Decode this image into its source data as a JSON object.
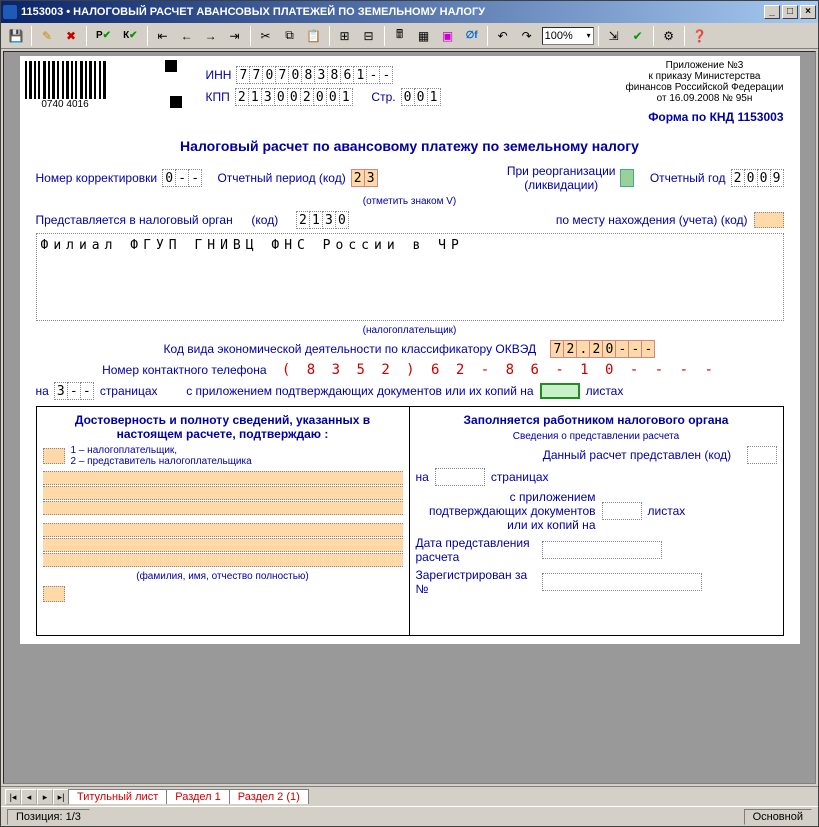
{
  "title": "1153003 • НАЛОГОВЫЙ РАСЧЕТ АВАНСОВЫХ ПЛАТЕЖЕЙ ПО ЗЕМЕЛЬНОМУ НАЛОГУ",
  "toolbar": {
    "zoom": "100%",
    "r": "Р",
    "k": "К"
  },
  "barcode_num": "0740 4016",
  "inn_label": "ИНН",
  "inn": [
    "7",
    "7",
    "0",
    "7",
    "0",
    "8",
    "3",
    "8",
    "6",
    "1",
    "-",
    "-"
  ],
  "kpp_label": "КПП",
  "kpp": [
    "2",
    "1",
    "3",
    "0",
    "0",
    "2",
    "0",
    "0",
    "1"
  ],
  "page_label": "Стр.",
  "page": [
    "0",
    "0",
    "1"
  ],
  "prilog": "Приложение №3\nк приказу Министерства\nфинансов Российской Федерации\nот 16.09.2008 № 95н",
  "form_knd": "Форма по КНД 1153003",
  "main_title": "Налоговый расчет по авансовому платежу по земельному налогу",
  "korr_label": "Номер корректировки",
  "korr": [
    "0",
    "-",
    "-"
  ],
  "period_label": "Отчетный период (код)",
  "period": [
    "2",
    "3"
  ],
  "reorg": "При реорганизации\n(ликвидации)",
  "year_label": "Отчетный год",
  "year": [
    "2",
    "0",
    "0",
    "9"
  ],
  "mark_v": "(отметить знаком V)",
  "pred_label": "Представляется в налоговый орган",
  "kod": "(код)",
  "organ": [
    "2",
    "1",
    "3",
    "0"
  ],
  "mesto": "по месту нахождения (учета) (код)",
  "payer": "Филиал ФГУП ГНИВЦ ФНС России в ЧР",
  "payer_note": "(налогоплательщик)",
  "okved_label": "Код вида экономической деятельности по классификатору ОКВЭД",
  "okved": [
    "7",
    "2",
    ".",
    "2",
    "0",
    "-",
    "-",
    "-"
  ],
  "phone_label": "Номер контактного телефона",
  "phone": "( 8 3 5 2 )   6 2 - 8 6 - 1 0 - - - -",
  "na": "на",
  "pages_cells": [
    "3",
    "-",
    "-"
  ],
  "pages_word": "страницах",
  "attach": "с приложением подтверждающих документов или их копий на",
  "sheets": "листах",
  "left_h": "Достоверность и полноту сведений, указанных в настоящем расчете, подтверждаю :",
  "opt1": "1 – налогоплательщик,",
  "opt2": "2 – представитель налогоплательщика",
  "fio": "(фамилия, имя, отчество полностью)",
  "right_h": "Заполняется работником налогового органа",
  "sved": "Сведения о представлении расчета",
  "dt_kod": "Данный расчет представлен (код)",
  "r_na": "на",
  "r_pages": "страницах",
  "r_attach": "с приложением подтверждающих документов или их копий на",
  "r_sheets": "листах",
  "date_pred": "Дата представления расчета",
  "reg_no": "Зарегистрирован за №",
  "tabs": {
    "t1": "Титульный лист",
    "t2": "Раздел 1",
    "t3": "Раздел 2 (1)"
  },
  "status": {
    "pos": "Позиция: 1/3",
    "mode": "Основной"
  }
}
